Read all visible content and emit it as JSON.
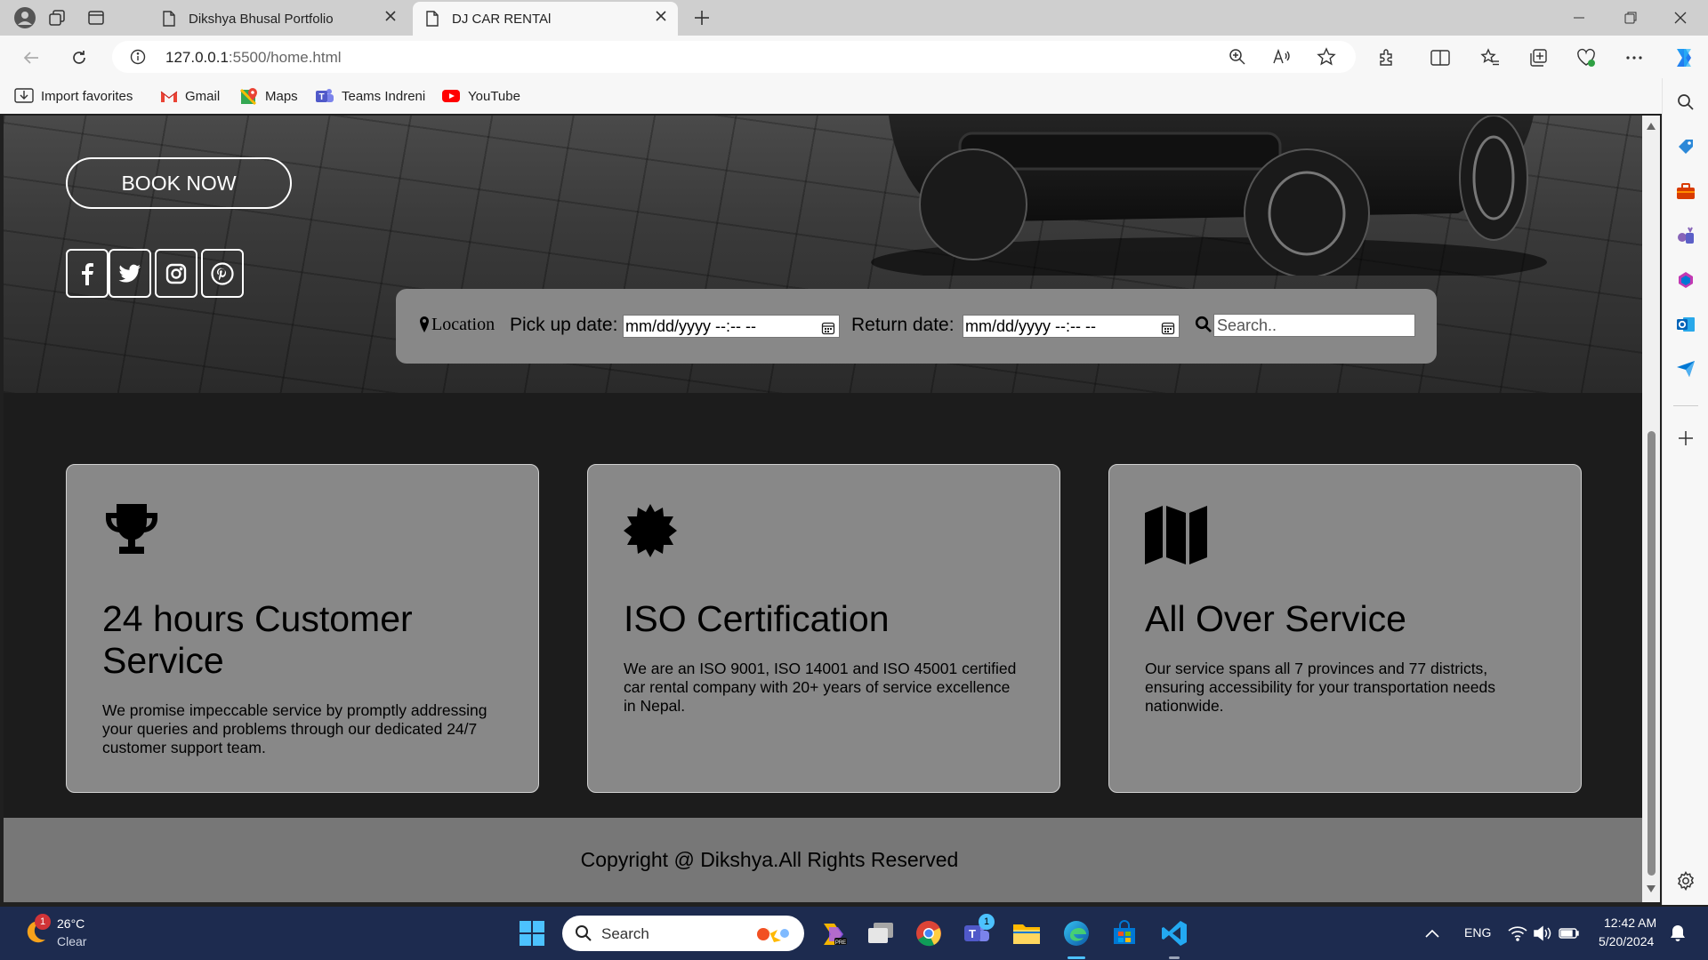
{
  "browser": {
    "tabs": [
      {
        "title": "Dikshya Bhusal Portfolio",
        "active": false
      },
      {
        "title": "DJ CAR RENTAl",
        "active": true
      }
    ],
    "url_host": "127.0.0.1",
    "url_path": ":5500/home.html",
    "favorites": [
      {
        "label": "Import favorites",
        "icon": "import-icon"
      },
      {
        "label": "Gmail",
        "icon": "gmail-icon"
      },
      {
        "label": "Maps",
        "icon": "maps-icon"
      },
      {
        "label": "Teams Indreni",
        "icon": "teams-icon"
      },
      {
        "label": "YouTube",
        "icon": "youtube-icon"
      }
    ]
  },
  "hero": {
    "book_now": "BOOK NOW",
    "social": [
      "facebook-icon",
      "twitter-icon",
      "instagram-icon",
      "pinterest-icon"
    ],
    "search": {
      "location_label": "Location",
      "pickup_label": "Pick up date:",
      "pickup_value": "mm/dd/yyyy --:-- --",
      "return_label": "Return date:",
      "return_value": "mm/dd/yyyy --:-- --",
      "search_placeholder": "Search.."
    }
  },
  "cards": [
    {
      "icon": "trophy-icon",
      "title": "24 hours Customer Service",
      "desc": "We promise impeccable service by promptly addressing your queries and problems through our dedicated 24/7 customer support team."
    },
    {
      "icon": "certificate-icon",
      "title": "ISO Certification",
      "desc": "We are an ISO 9001, ISO 14001 and ISO 45001 certified car rental company with 20+ years of service excellence in Nepal."
    },
    {
      "icon": "map-icon",
      "title": "All Over Service",
      "desc": "Our service spans all 7 provinces and 77 districts, ensuring accessibility for your transportation needs nationwide."
    }
  ],
  "footer": {
    "text": "Copyright @ Dikshya.All Rights Reserved"
  },
  "taskbar": {
    "weather_temp": "26°C",
    "weather_desc": "Clear",
    "weather_badge": "1",
    "search_label": "Search",
    "teams_badge": "1",
    "lang": "ENG",
    "time": "12:42 AM",
    "date": "5/20/2024"
  },
  "colors": {
    "accent": "#0067c0",
    "card_bg": "#888888",
    "footer_bg": "#777777",
    "taskbar_bg": "#1d2b4f"
  }
}
